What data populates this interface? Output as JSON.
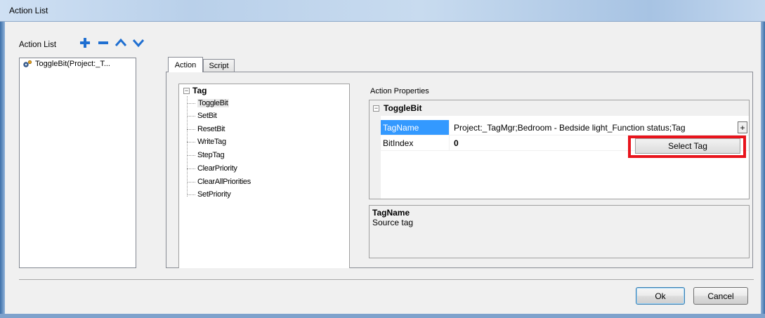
{
  "window": {
    "title": "Action List"
  },
  "action_list": {
    "label": "Action List",
    "toolbar": [
      "add-icon",
      "remove-icon",
      "move-up-icon",
      "move-down-icon"
    ],
    "items": [
      {
        "label": "ToggleBit(Project:_T...",
        "icon": "gear-icon"
      }
    ]
  },
  "tabs": [
    {
      "label": "Action",
      "active": true
    },
    {
      "label": "Script",
      "active": false
    }
  ],
  "tree": {
    "root": "Tag",
    "items": [
      "ToggleBit",
      "SetBit",
      "ResetBit",
      "WriteTag",
      "StepTag",
      "ClearPriority",
      "ClearAllPriorities",
      "SetPriority"
    ],
    "selected": "ToggleBit"
  },
  "properties": {
    "label": "Action Properties",
    "category": "ToggleBit",
    "rows": [
      {
        "name": "TagName",
        "value": "Project:_TagMgr;Bedroom - Bedside light_Function status;Tag",
        "selected": true,
        "button": "+"
      },
      {
        "name": "BitIndex",
        "value": "0",
        "selected": false
      }
    ],
    "select_tag_label": "Select Tag",
    "description": {
      "title": "TagName",
      "text": "Source tag"
    }
  },
  "buttons": {
    "ok": "Ok",
    "cancel": "Cancel"
  },
  "colors": {
    "highlight": "#e8141c",
    "selection": "#3399ff",
    "icon_blue": "#1f6fd1"
  }
}
